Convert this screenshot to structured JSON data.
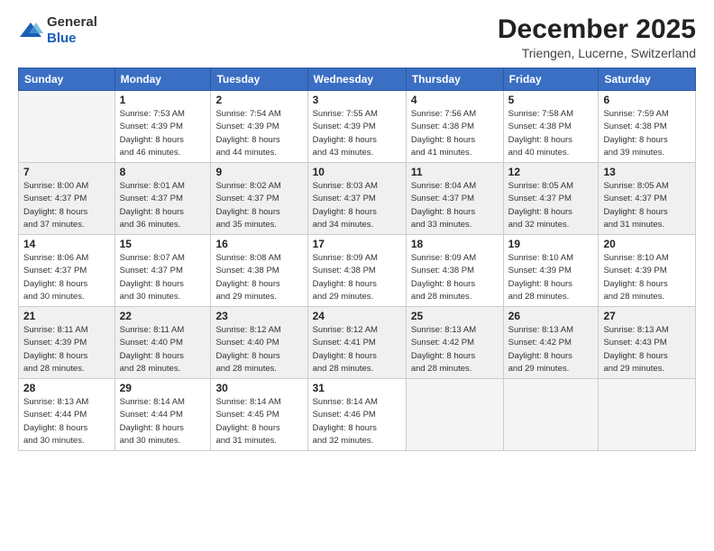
{
  "logo": {
    "general": "General",
    "blue": "Blue"
  },
  "title": "December 2025",
  "subtitle": "Triengen, Lucerne, Switzerland",
  "days_header": [
    "Sunday",
    "Monday",
    "Tuesday",
    "Wednesday",
    "Thursday",
    "Friday",
    "Saturday"
  ],
  "weeks": [
    [
      {
        "num": "",
        "info": ""
      },
      {
        "num": "1",
        "info": "Sunrise: 7:53 AM\nSunset: 4:39 PM\nDaylight: 8 hours\nand 46 minutes."
      },
      {
        "num": "2",
        "info": "Sunrise: 7:54 AM\nSunset: 4:39 PM\nDaylight: 8 hours\nand 44 minutes."
      },
      {
        "num": "3",
        "info": "Sunrise: 7:55 AM\nSunset: 4:39 PM\nDaylight: 8 hours\nand 43 minutes."
      },
      {
        "num": "4",
        "info": "Sunrise: 7:56 AM\nSunset: 4:38 PM\nDaylight: 8 hours\nand 41 minutes."
      },
      {
        "num": "5",
        "info": "Sunrise: 7:58 AM\nSunset: 4:38 PM\nDaylight: 8 hours\nand 40 minutes."
      },
      {
        "num": "6",
        "info": "Sunrise: 7:59 AM\nSunset: 4:38 PM\nDaylight: 8 hours\nand 39 minutes."
      }
    ],
    [
      {
        "num": "7",
        "info": "Sunrise: 8:00 AM\nSunset: 4:37 PM\nDaylight: 8 hours\nand 37 minutes."
      },
      {
        "num": "8",
        "info": "Sunrise: 8:01 AM\nSunset: 4:37 PM\nDaylight: 8 hours\nand 36 minutes."
      },
      {
        "num": "9",
        "info": "Sunrise: 8:02 AM\nSunset: 4:37 PM\nDaylight: 8 hours\nand 35 minutes."
      },
      {
        "num": "10",
        "info": "Sunrise: 8:03 AM\nSunset: 4:37 PM\nDaylight: 8 hours\nand 34 minutes."
      },
      {
        "num": "11",
        "info": "Sunrise: 8:04 AM\nSunset: 4:37 PM\nDaylight: 8 hours\nand 33 minutes."
      },
      {
        "num": "12",
        "info": "Sunrise: 8:05 AM\nSunset: 4:37 PM\nDaylight: 8 hours\nand 32 minutes."
      },
      {
        "num": "13",
        "info": "Sunrise: 8:05 AM\nSunset: 4:37 PM\nDaylight: 8 hours\nand 31 minutes."
      }
    ],
    [
      {
        "num": "14",
        "info": "Sunrise: 8:06 AM\nSunset: 4:37 PM\nDaylight: 8 hours\nand 30 minutes."
      },
      {
        "num": "15",
        "info": "Sunrise: 8:07 AM\nSunset: 4:37 PM\nDaylight: 8 hours\nand 30 minutes."
      },
      {
        "num": "16",
        "info": "Sunrise: 8:08 AM\nSunset: 4:38 PM\nDaylight: 8 hours\nand 29 minutes."
      },
      {
        "num": "17",
        "info": "Sunrise: 8:09 AM\nSunset: 4:38 PM\nDaylight: 8 hours\nand 29 minutes."
      },
      {
        "num": "18",
        "info": "Sunrise: 8:09 AM\nSunset: 4:38 PM\nDaylight: 8 hours\nand 28 minutes."
      },
      {
        "num": "19",
        "info": "Sunrise: 8:10 AM\nSunset: 4:39 PM\nDaylight: 8 hours\nand 28 minutes."
      },
      {
        "num": "20",
        "info": "Sunrise: 8:10 AM\nSunset: 4:39 PM\nDaylight: 8 hours\nand 28 minutes."
      }
    ],
    [
      {
        "num": "21",
        "info": "Sunrise: 8:11 AM\nSunset: 4:39 PM\nDaylight: 8 hours\nand 28 minutes."
      },
      {
        "num": "22",
        "info": "Sunrise: 8:11 AM\nSunset: 4:40 PM\nDaylight: 8 hours\nand 28 minutes."
      },
      {
        "num": "23",
        "info": "Sunrise: 8:12 AM\nSunset: 4:40 PM\nDaylight: 8 hours\nand 28 minutes."
      },
      {
        "num": "24",
        "info": "Sunrise: 8:12 AM\nSunset: 4:41 PM\nDaylight: 8 hours\nand 28 minutes."
      },
      {
        "num": "25",
        "info": "Sunrise: 8:13 AM\nSunset: 4:42 PM\nDaylight: 8 hours\nand 28 minutes."
      },
      {
        "num": "26",
        "info": "Sunrise: 8:13 AM\nSunset: 4:42 PM\nDaylight: 8 hours\nand 29 minutes."
      },
      {
        "num": "27",
        "info": "Sunrise: 8:13 AM\nSunset: 4:43 PM\nDaylight: 8 hours\nand 29 minutes."
      }
    ],
    [
      {
        "num": "28",
        "info": "Sunrise: 8:13 AM\nSunset: 4:44 PM\nDaylight: 8 hours\nand 30 minutes."
      },
      {
        "num": "29",
        "info": "Sunrise: 8:14 AM\nSunset: 4:44 PM\nDaylight: 8 hours\nand 30 minutes."
      },
      {
        "num": "30",
        "info": "Sunrise: 8:14 AM\nSunset: 4:45 PM\nDaylight: 8 hours\nand 31 minutes."
      },
      {
        "num": "31",
        "info": "Sunrise: 8:14 AM\nSunset: 4:46 PM\nDaylight: 8 hours\nand 32 minutes."
      },
      {
        "num": "",
        "info": ""
      },
      {
        "num": "",
        "info": ""
      },
      {
        "num": "",
        "info": ""
      }
    ]
  ]
}
